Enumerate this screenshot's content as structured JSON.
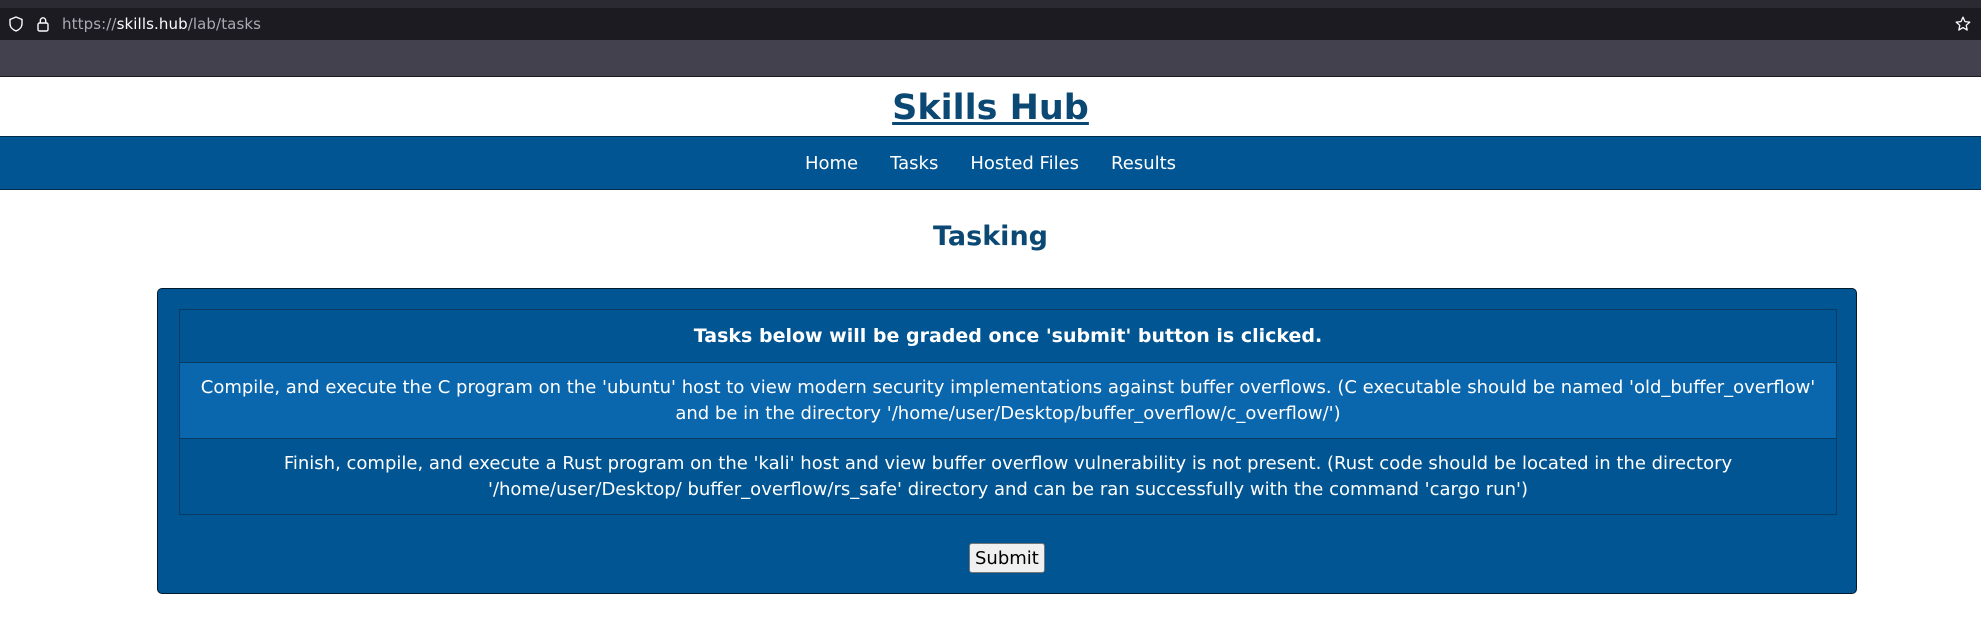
{
  "browser": {
    "url_scheme": "https://",
    "url_host": "skills.hub",
    "url_path": "/lab/tasks",
    "icons": [
      "shield-icon",
      "lock-icon",
      "star-icon"
    ]
  },
  "site": {
    "title": "Skills Hub"
  },
  "nav": {
    "items": [
      {
        "label": "Home"
      },
      {
        "label": "Tasks"
      },
      {
        "label": "Hosted Files"
      },
      {
        "label": "Results"
      }
    ]
  },
  "main": {
    "heading": "Tasking",
    "table_header": "Tasks below will be graded once 'submit' button is clicked.",
    "tasks": [
      {
        "text": "Compile, and execute the C program on the 'ubuntu' host to view modern security implementations against buffer overflows. (C executable should be named 'old_buffer_overflow' and be in the directory '/home/user/Desktop/buffer_overflow/c_overflow/')"
      },
      {
        "text": "Finish, compile, and execute a Rust program on the 'kali' host and view buffer overflow vulnerability is not present. (Rust code should be located in the directory '/home/user/Desktop/ buffer_overflow/rs_safe' directory and can be ran successfully with the command 'cargo run')"
      }
    ],
    "submit_label": "Submit"
  },
  "colors": {
    "brand_blue": "#005592",
    "title_blue": "#0b4873",
    "row_highlight": "#0a66ad"
  }
}
